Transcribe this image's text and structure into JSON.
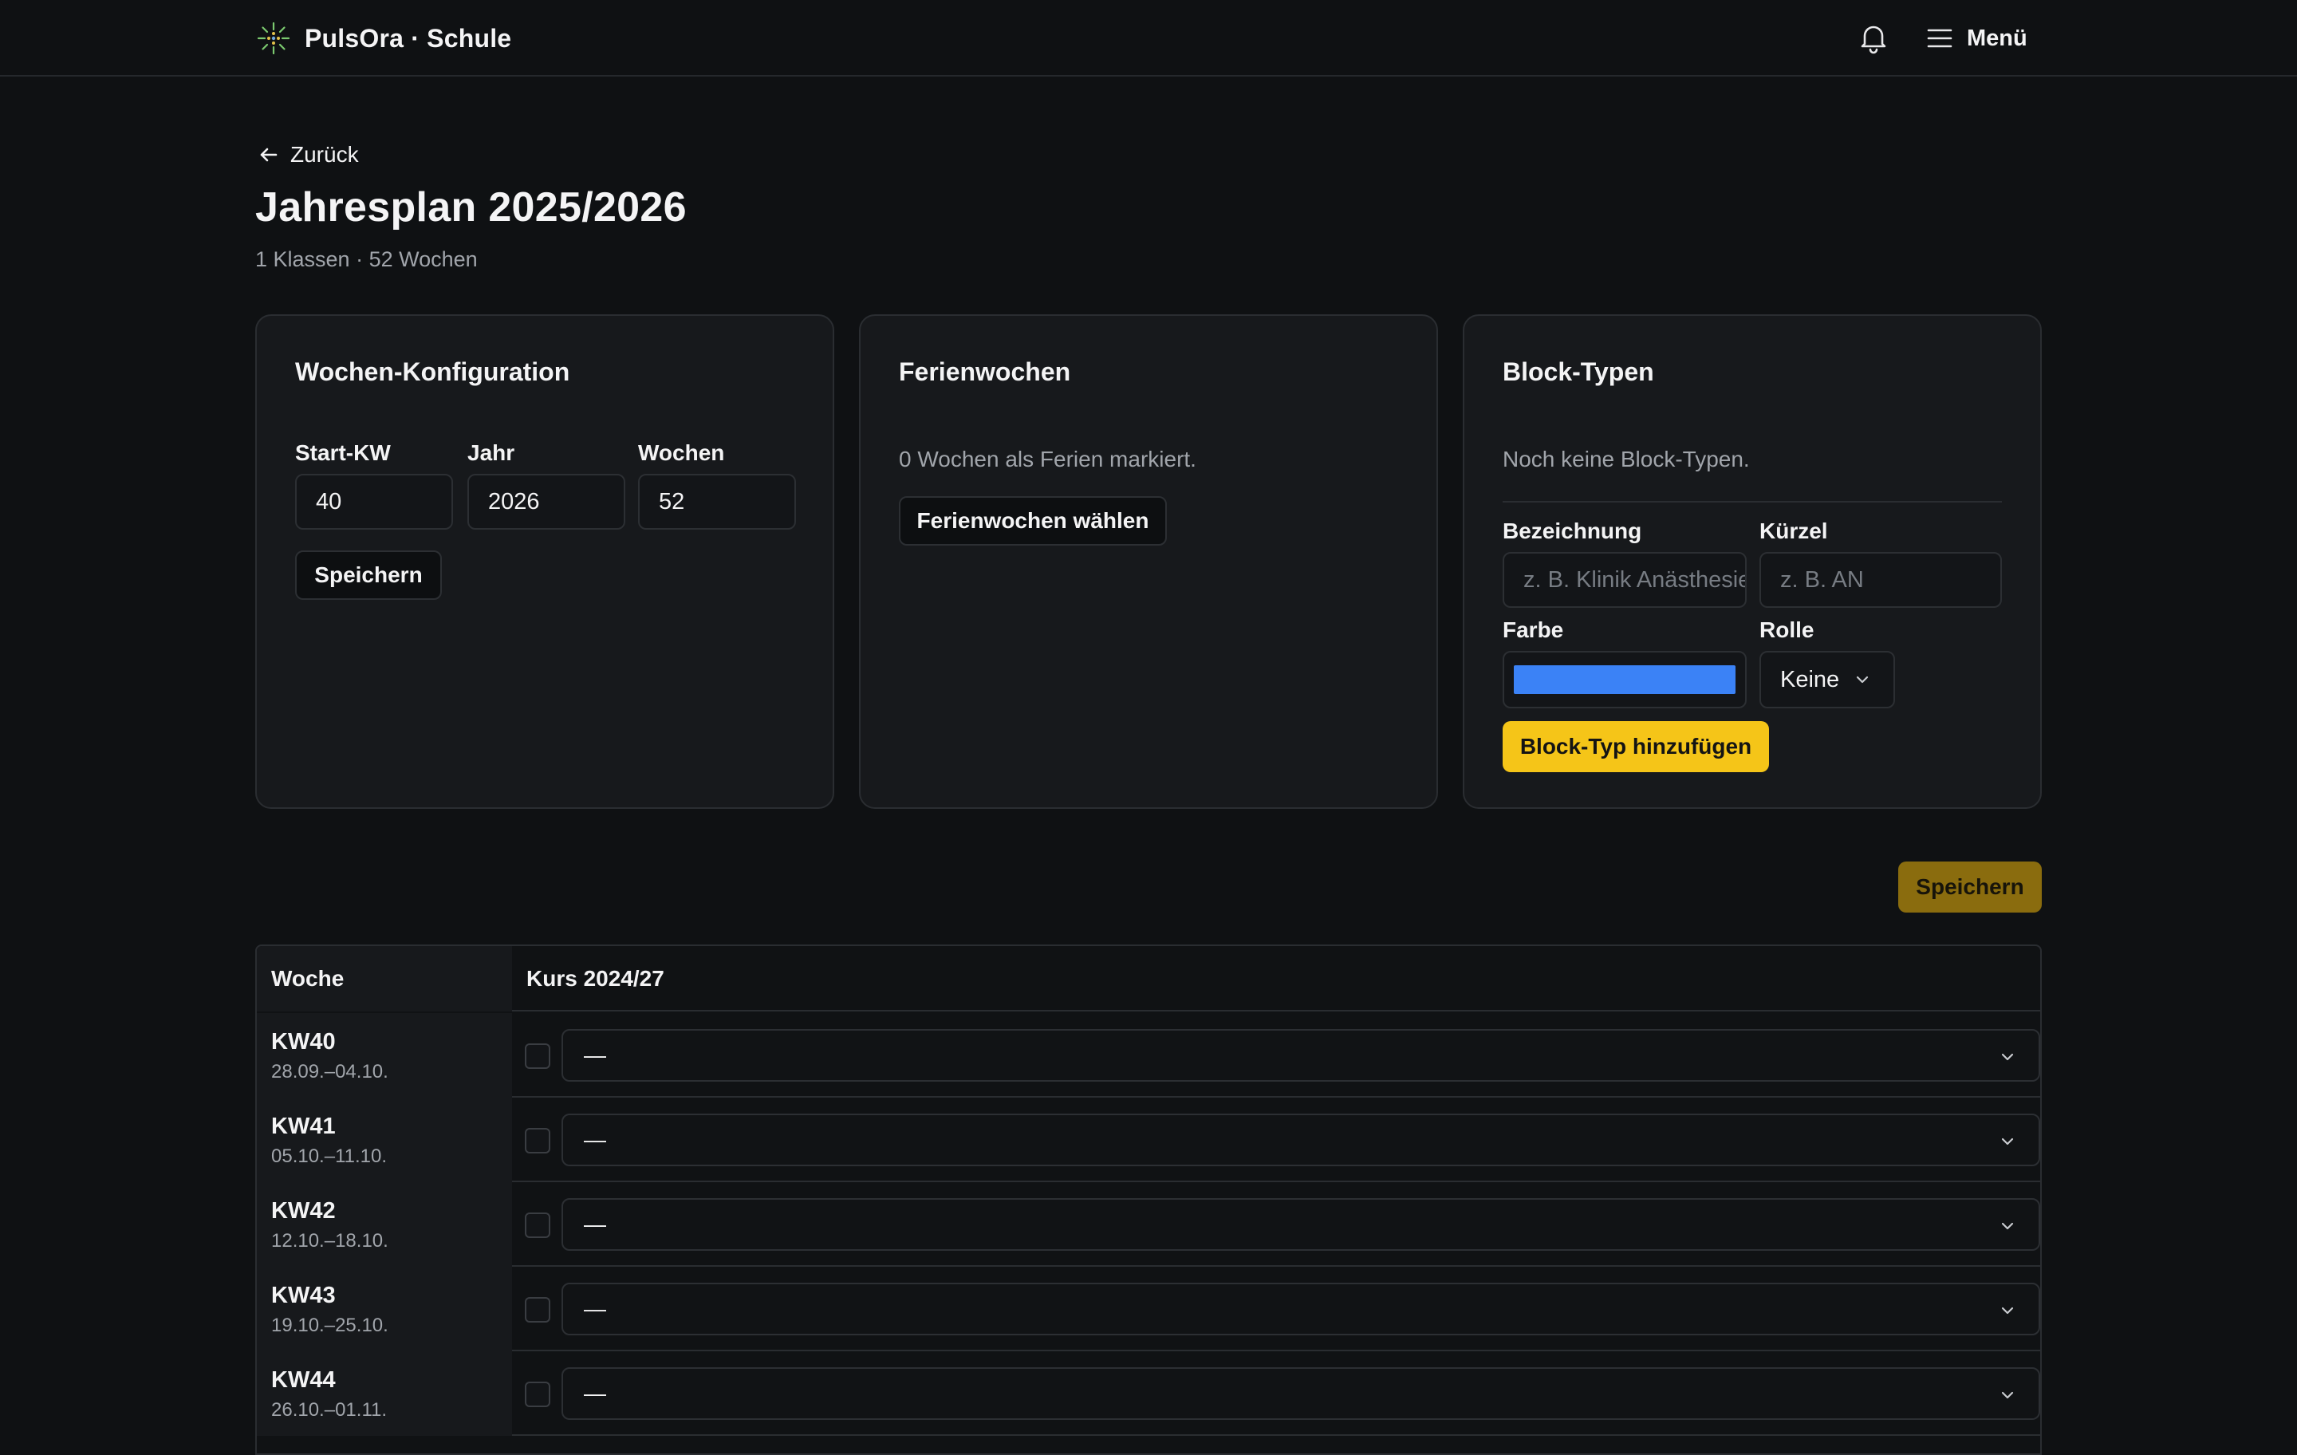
{
  "header": {
    "brand": "PulsOra · Schule",
    "menu_label": "Menü",
    "icons": {
      "logo": "sparkle-logo-icon",
      "bell": "bell-icon",
      "menu": "hamburger-icon"
    }
  },
  "page": {
    "back_label": "Zurück",
    "title": "Jahresplan 2025/2026",
    "subtitle": "1 Klassen · 52 Wochen"
  },
  "week_config": {
    "title": "Wochen-Konfiguration",
    "start_label": "Start-KW",
    "start_value": "40",
    "year_label": "Jahr",
    "year_value": "2026",
    "weeks_label": "Wochen",
    "weeks_value": "52",
    "save_label": "Speichern"
  },
  "holidays": {
    "title": "Ferienwochen",
    "status": "0 Wochen als Ferien markiert.",
    "choose_label": "Ferienwochen wählen"
  },
  "block_types": {
    "title": "Block-Typen",
    "empty_text": "Noch keine Block-Typen.",
    "name_label": "Bezeichnung",
    "name_placeholder": "z. B. Klinik Anästhesie",
    "short_label": "Kürzel",
    "short_placeholder": "z. B. AN",
    "color_label": "Farbe",
    "color_value": "#3b82f6",
    "role_label": "Rolle",
    "role_value": "Keine",
    "add_label": "Block-Typ hinzufügen"
  },
  "main_save_label": "Speichern",
  "table": {
    "col_week": "Woche",
    "col_course": "Kurs 2024/27",
    "rows": [
      {
        "kw": "KW40",
        "dates": "28.09.–04.10.",
        "value": "—"
      },
      {
        "kw": "KW41",
        "dates": "05.10.–11.10.",
        "value": "—"
      },
      {
        "kw": "KW42",
        "dates": "12.10.–18.10.",
        "value": "—"
      },
      {
        "kw": "KW43",
        "dates": "19.10.–25.10.",
        "value": "—"
      },
      {
        "kw": "KW44",
        "dates": "26.10.–01.11.",
        "value": "—"
      }
    ]
  },
  "colors": {
    "background": "#0f1113",
    "card": "#17191c",
    "accent": "#f5c518",
    "accent_dim": "#8a6c0e",
    "swatch": "#3b82f6"
  }
}
